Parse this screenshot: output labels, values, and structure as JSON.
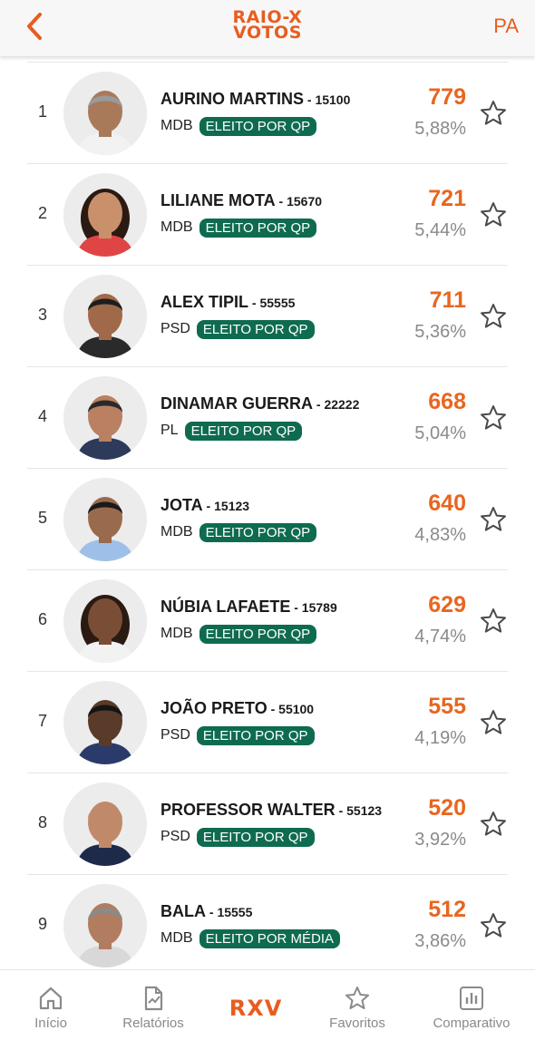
{
  "header": {
    "logo_line1": "RAIO-X",
    "logo_line2": "VOTOS",
    "state": "PA"
  },
  "colors": {
    "accent": "#e85d1f",
    "badge": "#0f6b50",
    "votes": "#e8661f",
    "percent": "#8a8a8a"
  },
  "candidates": [
    {
      "rank": "1",
      "name": "AURINO MARTINS",
      "number": "15100",
      "party": "MDB",
      "status": "ELEITO POR QP",
      "votes": "779",
      "percent": "5,88%"
    },
    {
      "rank": "2",
      "name": "LILIANE MOTA",
      "number": "15670",
      "party": "MDB",
      "status": "ELEITO POR QP",
      "votes": "721",
      "percent": "5,44%"
    },
    {
      "rank": "3",
      "name": "ALEX TIPIL",
      "number": "55555",
      "party": "PSD",
      "status": "ELEITO POR QP",
      "votes": "711",
      "percent": "5,36%"
    },
    {
      "rank": "4",
      "name": "DINAMAR GUERRA",
      "number": "22222",
      "party": "PL",
      "status": "ELEITO POR QP",
      "votes": "668",
      "percent": "5,04%"
    },
    {
      "rank": "5",
      "name": "JOTA",
      "number": "15123",
      "party": "MDB",
      "status": "ELEITO POR QP",
      "votes": "640",
      "percent": "4,83%"
    },
    {
      "rank": "6",
      "name": "NÚBIA LAFAETE",
      "number": "15789",
      "party": "MDB",
      "status": "ELEITO POR QP",
      "votes": "629",
      "percent": "4,74%"
    },
    {
      "rank": "7",
      "name": "JOÃO PRETO",
      "number": "55100",
      "party": "PSD",
      "status": "ELEITO POR QP",
      "votes": "555",
      "percent": "4,19%"
    },
    {
      "rank": "8",
      "name": "PROFESSOR WALTER",
      "number": "55123",
      "party": "PSD",
      "status": "ELEITO POR QP",
      "votes": "520",
      "percent": "3,92%"
    },
    {
      "rank": "9",
      "name": "BALA",
      "number": "15555",
      "party": "MDB",
      "status": "ELEITO POR MÉDIA",
      "votes": "512",
      "percent": "3,86%"
    }
  ],
  "nav": {
    "home": "Início",
    "reports": "Relatórios",
    "center": "RXV",
    "favorites": "Favoritos",
    "compare": "Comparativo"
  },
  "icons": {
    "back": "chevron-left-icon",
    "star": "star-outline-icon",
    "home": "home-icon",
    "reports": "report-document-icon",
    "favorites": "star-icon",
    "compare": "bar-chart-icon"
  }
}
